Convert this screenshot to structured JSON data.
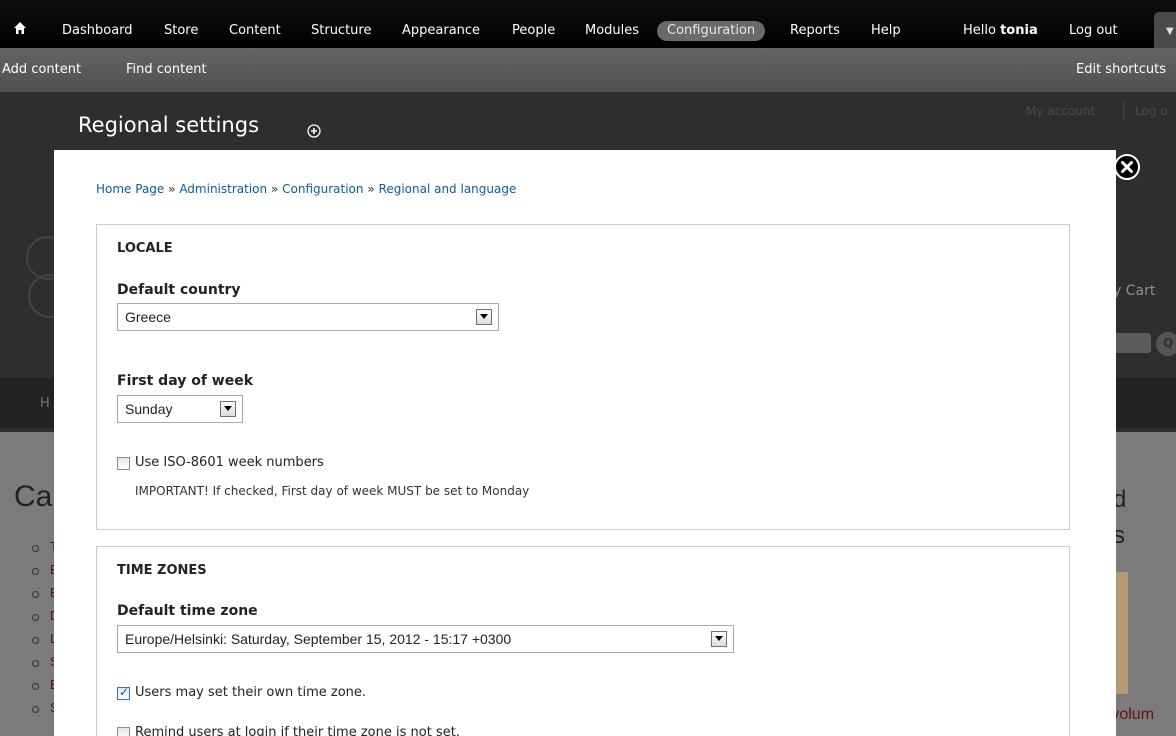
{
  "toolbar": {
    "menu": [
      "Dashboard",
      "Store",
      "Content",
      "Structure",
      "Appearance",
      "People",
      "Modules",
      "Configuration",
      "Reports",
      "Help"
    ],
    "active": "Configuration",
    "hello_prefix": "Hello",
    "username": "tonia",
    "logout": "Log out",
    "shortcuts": [
      "Add content",
      "Find content"
    ],
    "edit_shortcuts": "Edit shortcuts"
  },
  "background": {
    "my_account": "My account",
    "log_out": "Log o",
    "cart": "y Cart",
    "nav_fragment": "H",
    "heading_fragment": "Ca",
    "right_fragment_1": "d",
    "right_fragment_2": "s",
    "volume_fragment": "e volum",
    "list_letters": [
      "T",
      "E",
      "E",
      "D",
      "L",
      "S",
      "E",
      "S"
    ]
  },
  "page": {
    "title": "Regional settings",
    "breadcrumb": [
      "Home Page",
      "Administration",
      "Configuration",
      "Regional and language"
    ],
    "breadcrumb_sep": "»"
  },
  "locale": {
    "legend": "LOCALE",
    "default_country_label": "Default country",
    "default_country_value": "Greece",
    "first_day_label": "First day of week",
    "first_day_value": "Sunday",
    "iso_label": "Use ISO-8601 week numbers",
    "iso_checked": false,
    "iso_description": "IMPORTANT! If checked, First day of week MUST be set to Monday"
  },
  "timezones": {
    "legend": "TIME ZONES",
    "default_tz_label": "Default time zone",
    "default_tz_value": "Europe/Helsinki: Saturday, September 15, 2012 - 15:17 +0300",
    "users_set_label": "Users may set their own time zone.",
    "users_set_checked": true,
    "remind_label": "Remind users at login if their time zone is not set.",
    "remind_checked": false
  },
  "colors": {
    "link": "#0a5d9c",
    "toolbar_bg": "#000000",
    "shortcut_bg": "#5a5a5a",
    "active_pill": "#6a6a6a"
  }
}
